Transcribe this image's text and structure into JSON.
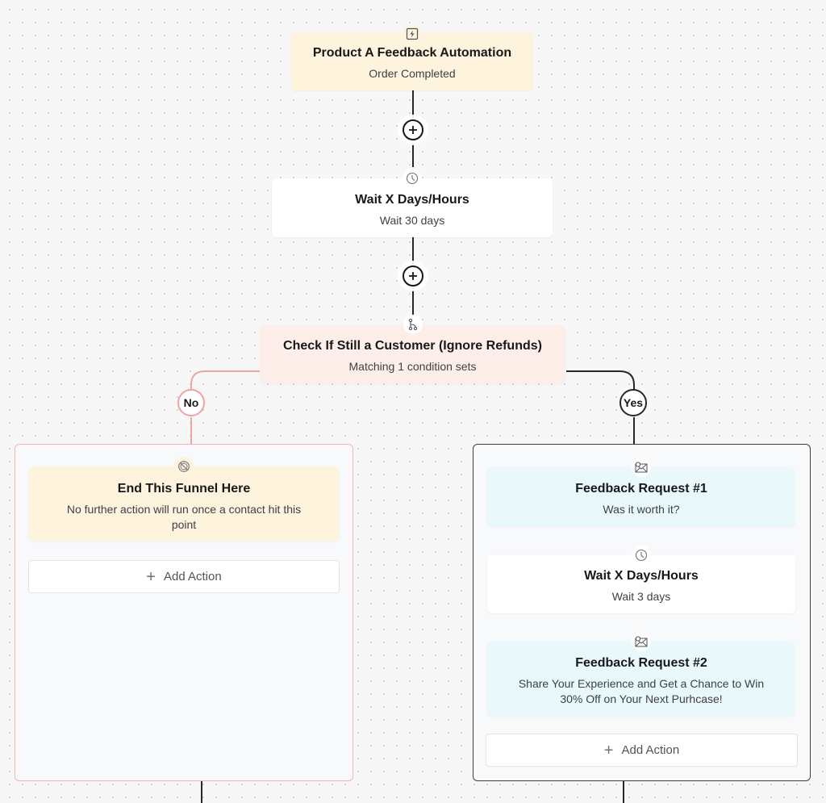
{
  "colors": {
    "trigger_bg": "#fef3dc",
    "wait_bg": "#ffffff",
    "condition_bg": "#feeee9",
    "end_bg": "#fef3dc",
    "email_bg": "#e8f8fb",
    "no_branch": "#f0a3a3",
    "yes_branch": "#27272a"
  },
  "trigger": {
    "icon": "lightning-icon",
    "title": "Product A Feedback Automation",
    "subtitle": "Order Completed"
  },
  "wait_1": {
    "icon": "clock-icon",
    "title": "Wait X Days/Hours",
    "subtitle": "Wait 30 days"
  },
  "condition": {
    "icon": "branch-icon",
    "title": "Check If Still a Customer (Ignore Refunds)",
    "subtitle": "Matching 1 condition sets"
  },
  "branches": {
    "no": {
      "label": "No",
      "end_node": {
        "icon": "end-funnel-icon",
        "title": "End This Funnel Here",
        "subtitle": "No further action will run once a contact hit this point"
      },
      "add_action_label": "Add Action"
    },
    "yes": {
      "label": "Yes",
      "email_1": {
        "icon": "email-icon",
        "title": "Feedback Request #1",
        "subtitle": "Was it worth it?"
      },
      "wait_2": {
        "icon": "clock-icon",
        "title": "Wait X Days/Hours",
        "subtitle": "Wait 3 days"
      },
      "email_2": {
        "icon": "email-icon",
        "title": "Feedback Request #2",
        "subtitle": "Share Your Experience and Get a Chance to Win 30% Off on Your Next Purhcase!"
      },
      "add_action_label": "Add Action"
    }
  }
}
